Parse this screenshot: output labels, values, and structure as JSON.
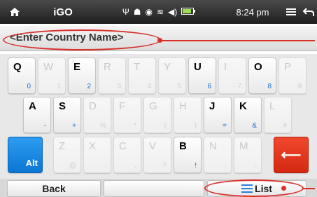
{
  "status_bar": {
    "home_icon": "home-icon",
    "app_title": "iGO",
    "time": "8:24 pm",
    "status_icons": [
      "usb-icon",
      "android-debug-icon",
      "gps-icon",
      "wifi-icon",
      "volume-icon",
      "battery-icon"
    ],
    "menu_icon": "menu-icon",
    "back_icon": "back-arrow-icon"
  },
  "search": {
    "placeholder": "<Enter Country Name>"
  },
  "keyboard": {
    "rows": [
      [
        {
          "main": "Q",
          "sub": "0",
          "enabled": true
        },
        {
          "main": "W",
          "sub": "1",
          "enabled": false
        },
        {
          "main": "E",
          "sub": "2",
          "enabled": true
        },
        {
          "main": "R",
          "sub": "3",
          "enabled": false
        },
        {
          "main": "T",
          "sub": "4",
          "enabled": false
        },
        {
          "main": "Y",
          "sub": "5",
          "enabled": false
        },
        {
          "main": "U",
          "sub": "6",
          "enabled": true
        },
        {
          "main": "I",
          "sub": "7",
          "enabled": false
        },
        {
          "main": "O",
          "sub": "8",
          "enabled": true
        },
        {
          "main": "P",
          "sub": "9",
          "enabled": false
        }
      ],
      [
        {
          "main": "A",
          "sub": "-",
          "enabled": true
        },
        {
          "main": "S",
          "sub": "+",
          "enabled": true
        },
        {
          "main": "D",
          "sub": "%",
          "enabled": false
        },
        {
          "main": "F",
          "sub": "*",
          "enabled": false
        },
        {
          "main": "G",
          "sub": "(",
          "enabled": false
        },
        {
          "main": "H",
          "sub": ")",
          "enabled": false
        },
        {
          "main": "J",
          "sub": "=",
          "enabled": true
        },
        {
          "main": "K",
          "sub": "&",
          "enabled": true
        },
        {
          "main": "L",
          "sub": "#",
          "enabled": false
        }
      ],
      [
        {
          "main": "Z",
          "sub": "@",
          "enabled": false
        },
        {
          "main": "X",
          "sub": ".",
          "enabled": false
        },
        {
          "main": "C",
          "sub": ",",
          "enabled": false
        },
        {
          "main": "V",
          "sub": "?",
          "enabled": false
        },
        {
          "main": "B",
          "sub": "!",
          "enabled": true
        },
        {
          "main": "N",
          "sub": ":",
          "enabled": false
        },
        {
          "main": "M",
          "sub": ";",
          "enabled": false
        }
      ]
    ],
    "alt_label": "Alt",
    "delete_icon": "backspace-arrow-icon"
  },
  "bottom": {
    "back_label": "Back",
    "list_label": "List",
    "list_icon": "list-icon"
  },
  "colors": {
    "accent_blue": "#1e6fd0",
    "alt_key": "#1a86e0",
    "delete_key": "#e0371d",
    "annotation": "#d9302a"
  }
}
